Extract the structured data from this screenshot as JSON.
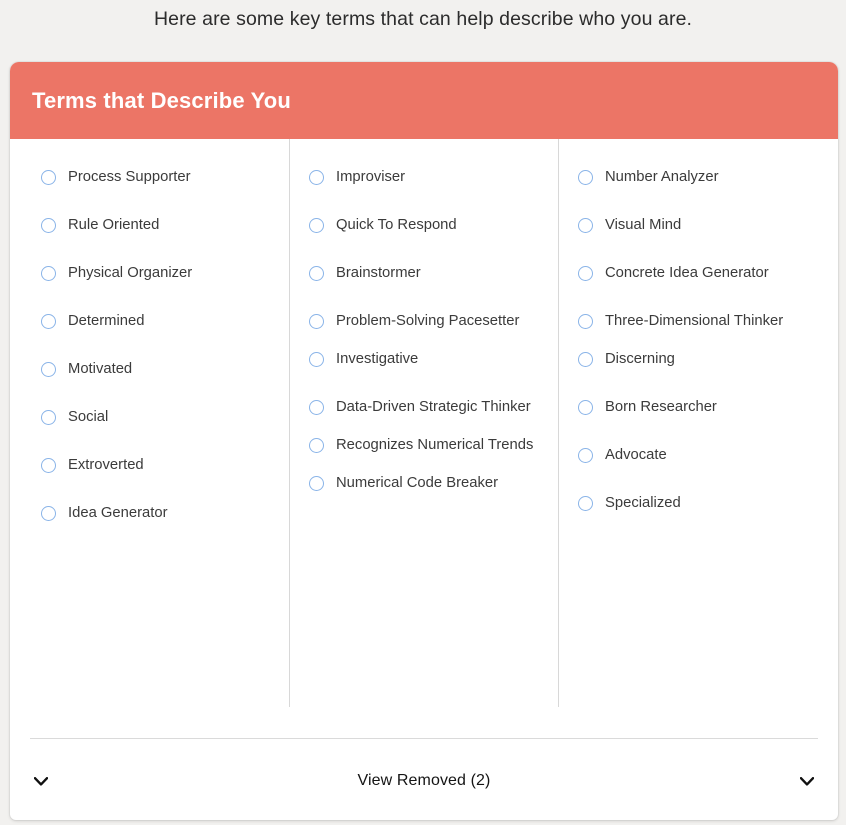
{
  "intro": {
    "heading": "Here are some key terms that can help describe who you are."
  },
  "card": {
    "header_title": "Terms that Describe You",
    "header_color": "#ec7566",
    "radio_color": "#8ab4e8",
    "columns": [
      {
        "id": "column-1",
        "items": [
          {
            "label": "Process Supporter"
          },
          {
            "label": "Rule Oriented"
          },
          {
            "label": "Physical Organizer"
          },
          {
            "label": "Determined"
          },
          {
            "label": "Motivated"
          },
          {
            "label": "Social"
          },
          {
            "label": "Extroverted"
          },
          {
            "label": "Idea Generator"
          }
        ]
      },
      {
        "id": "column-2",
        "items": [
          {
            "label": "Improviser"
          },
          {
            "label": "Quick To Respond"
          },
          {
            "label": "Brainstormer"
          },
          {
            "label": "Problem-Solving Pacesetter"
          },
          {
            "label": "Investigative"
          },
          {
            "label": "Data-Driven Strategic Thinker"
          },
          {
            "label": "Recognizes Numerical Trends"
          },
          {
            "label": "Numerical Code Breaker"
          }
        ]
      },
      {
        "id": "column-3",
        "items": [
          {
            "label": "Number Analyzer"
          },
          {
            "label": "Visual Mind"
          },
          {
            "label": "Concrete Idea Generator"
          },
          {
            "label": "Three-Dimensional Thinker"
          },
          {
            "label": "Discerning"
          },
          {
            "label": "Born Researcher"
          },
          {
            "label": "Advocate"
          },
          {
            "label": "Specialized"
          }
        ]
      }
    ],
    "footer": {
      "label": "View Removed (2)",
      "left_icon": "chevron-down-icon",
      "right_icon": "chevron-down-icon"
    }
  }
}
